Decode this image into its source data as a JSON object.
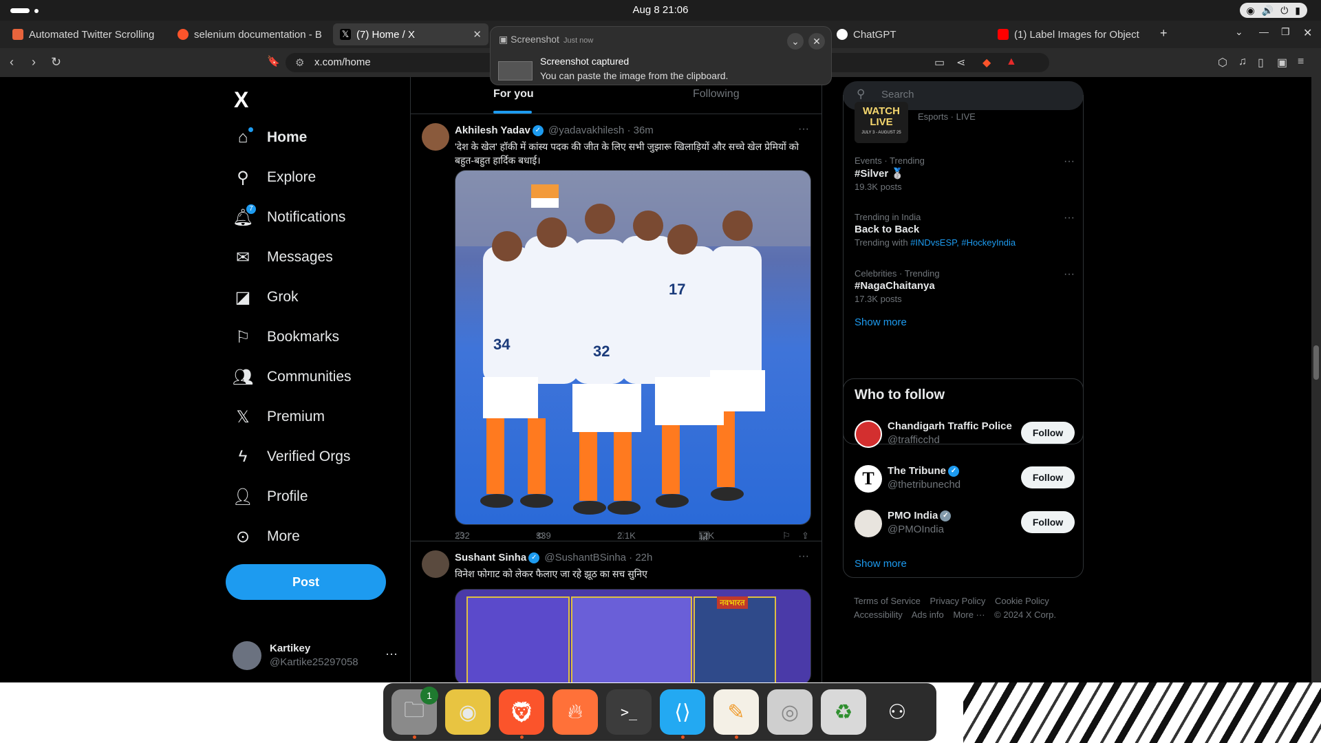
{
  "system": {
    "clock": "Aug 8  21:06"
  },
  "tabs": [
    {
      "label": "Automated Twitter Scrolling",
      "color": "#e8643c"
    },
    {
      "label": "selenium documentation - B",
      "color": "#fb542b"
    },
    {
      "label": "(7) Home / X",
      "color": "#000000"
    },
    {
      "label": "ChatGPT",
      "color": "#ffffff"
    },
    {
      "label": "(1) Label Images for Object",
      "color": "#ff0000"
    }
  ],
  "address": {
    "url": "x.com/home"
  },
  "notification": {
    "app": "Screenshot",
    "time": "Just now",
    "title": "Screenshot captured",
    "body": "You can paste the image from the clipboard."
  },
  "sidebar": {
    "logo": "X",
    "items": [
      {
        "label": "Home",
        "icon": "home-icon"
      },
      {
        "label": "Explore",
        "icon": "search-icon"
      },
      {
        "label": "Notifications",
        "icon": "bell-icon",
        "badge": "7"
      },
      {
        "label": "Messages",
        "icon": "mail-icon"
      },
      {
        "label": "Grok",
        "icon": "grok-icon"
      },
      {
        "label": "Bookmarks",
        "icon": "bookmark-icon"
      },
      {
        "label": "Communities",
        "icon": "people-icon"
      },
      {
        "label": "Premium",
        "icon": "x-icon"
      },
      {
        "label": "Verified Orgs",
        "icon": "lightning-icon"
      },
      {
        "label": "Profile",
        "icon": "user-icon"
      },
      {
        "label": "More",
        "icon": "more-circle-icon"
      }
    ],
    "post_label": "Post",
    "account": {
      "name": "Kartikey",
      "handle": "@Kartike25297058"
    }
  },
  "feed": {
    "tab_for_you": "For you",
    "tab_following": "Following",
    "tweets": [
      {
        "name": "Akhilesh Yadav",
        "handle": "@yadavakhilesh",
        "time": "· 36m",
        "text": "'देश के खेल' हॉकी में कांस्य पदक की जीत के लिए सभी जुझारू खिलाड़ियों और सच्चे खेल प्रेमियों को बहुत-बहुत हार्दिक बधाई।",
        "replies": "232",
        "reposts": "339",
        "likes": "2.1K",
        "views": "12K"
      },
      {
        "name": "Sushant Sinha",
        "handle": "@SushantBSinha",
        "time": "· 22h",
        "text": "विनेश फोगाट को लेकर फैलाए जा रहे झूठ का सच सुनिए",
        "media_badge": "नवभारत"
      }
    ]
  },
  "right": {
    "search_placeholder": "Search",
    "esports": {
      "badge": "WATCH LIVE",
      "dates": "JULY 3 - AUGUST 25",
      "meta": "Esports · LIVE"
    },
    "trends": [
      {
        "meta": "Events · Trending",
        "title": "#Silver 🥈",
        "count": "19.3K posts"
      },
      {
        "meta": "Trending in India",
        "title": "Back to Back",
        "count_prefix": "Trending with",
        "tags": "#INDvsESP, #HockeyIndia"
      },
      {
        "meta": "Celebrities · Trending",
        "title": "#NagaChaitanya",
        "count": "17.3K posts"
      }
    ],
    "show_more": "Show more",
    "who_to_follow": {
      "title": "Who to follow",
      "accounts": [
        {
          "name": "Chandigarh Traffic Police",
          "handle": "@trafficchd",
          "button": "Follow"
        },
        {
          "name": "The Tribune",
          "handle": "@thetribunechd",
          "button": "Follow"
        },
        {
          "name": "PMO India",
          "handle": "@PMOIndia",
          "button": "Follow"
        }
      ],
      "show_more": "Show more"
    },
    "footer": [
      "Terms of Service",
      "Privacy Policy",
      "Cookie Policy",
      "Accessibility",
      "Ads info",
      "More ···",
      "© 2024 X Corp."
    ]
  },
  "dock": {
    "files_badge": "1",
    "items": [
      "files-icon",
      "rhythmbox-icon",
      "brave-icon",
      "firefox-icon",
      "terminal-icon",
      "vscode-icon",
      "text-editor-icon",
      "disk-icon",
      "trash-icon",
      "ubuntu-icon"
    ]
  }
}
